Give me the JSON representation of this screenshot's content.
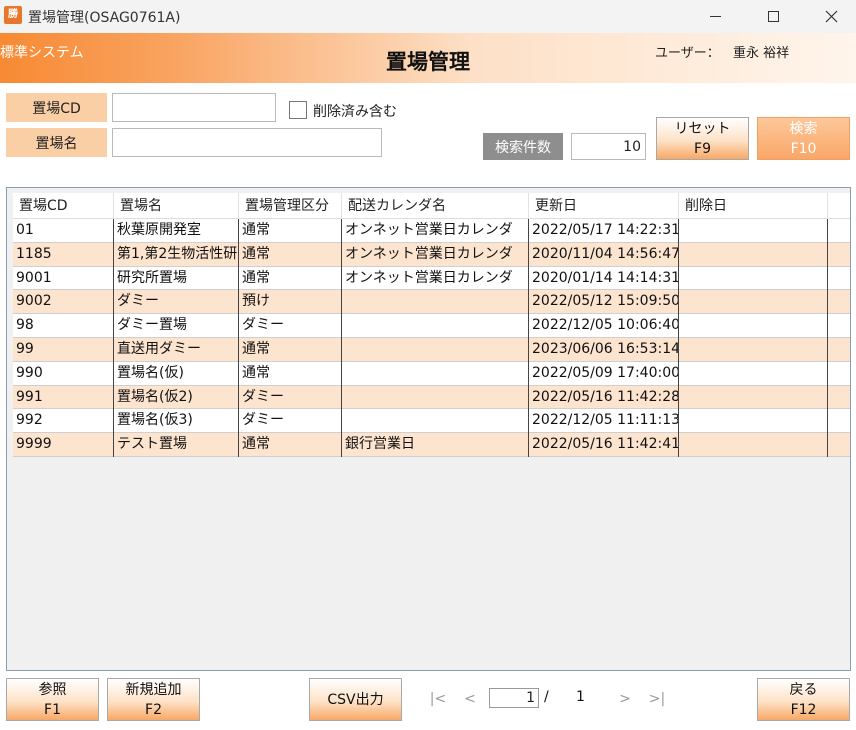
{
  "window": {
    "title": "置場管理(OSAG0761A)",
    "icon_text": "勝"
  },
  "header": {
    "system_name": "標準システム",
    "page_title": "置場管理",
    "user_label": "ユーザー：",
    "user_name": "重永 裕祥"
  },
  "search": {
    "code_label": "置場CD",
    "code_value": "",
    "name_label": "置場名",
    "name_value": "",
    "include_deleted_label": "削除済み含む",
    "include_deleted_checked": false,
    "count_label": "検索件数",
    "count_value": "10",
    "reset_label": "リセット",
    "reset_key": "F9",
    "search_label": "検索",
    "search_key": "F10"
  },
  "grid": {
    "columns": [
      "置場CD",
      "置場名",
      "置場管理区分",
      "配送カレンダ名",
      "更新日",
      "削除日"
    ],
    "rows": [
      [
        "01",
        "秋葉原開発室",
        "通常",
        "オンネット営業日カレンダ",
        "2022/05/17 14:22:31",
        ""
      ],
      [
        "1185",
        "第1,第2生物活性研",
        "通常",
        "オンネット営業日カレンダ",
        "2020/11/04 14:56:47",
        ""
      ],
      [
        "9001",
        "研究所置場",
        "通常",
        "オンネット営業日カレンダ",
        "2020/01/14 14:14:31",
        ""
      ],
      [
        "9002",
        "ダミー",
        "預け",
        "",
        "2022/05/12 15:09:50",
        ""
      ],
      [
        "98",
        "ダミー置場",
        "ダミー",
        "",
        "2022/12/05 10:06:40",
        ""
      ],
      [
        "99",
        "直送用ダミー",
        "通常",
        "",
        "2023/06/06 16:53:14",
        ""
      ],
      [
        "990",
        "置場名(仮)",
        "通常",
        "",
        "2022/05/09 17:40:00",
        ""
      ],
      [
        "991",
        "置場名(仮2)",
        "ダミー",
        "",
        "2022/05/16 11:42:28",
        ""
      ],
      [
        "992",
        "置場名(仮3)",
        "ダミー",
        "",
        "2022/12/05 11:11:13",
        ""
      ],
      [
        "9999",
        "テスト置場",
        "通常",
        "銀行営業日",
        "2022/05/16 11:42:41",
        ""
      ]
    ]
  },
  "footer": {
    "ref_label": "参照",
    "ref_key": "F1",
    "add_label": "新規追加",
    "add_key": "F2",
    "csv_label": "CSV出力",
    "back_label": "戻る",
    "back_key": "F12",
    "pager": {
      "first": "|<",
      "prev": "<",
      "next": ">",
      "last": ">|",
      "current_page": "1",
      "separator": "/",
      "total_pages": "1"
    }
  }
}
